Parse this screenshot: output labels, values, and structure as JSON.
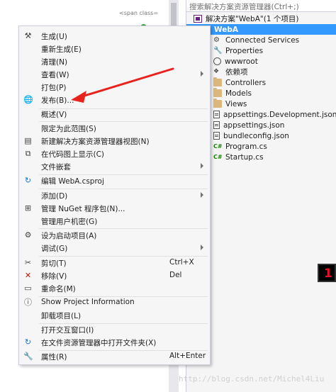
{
  "editor": {
    "top_snippet": "<span class="
  },
  "explorer": {
    "search_placeholder": "搜索解决方案资源管理器(Ctrl+;)",
    "items": [
      {
        "label": "解决方案\"WebA\"(1 个项目)",
        "icon": "solution-icon",
        "selected": false
      },
      {
        "label": "WebA",
        "icon": "project-icon",
        "selected": true
      },
      {
        "label": "Connected Services",
        "icon": "connected-services-icon",
        "selected": false
      },
      {
        "label": "Properties",
        "icon": "properties-icon",
        "selected": false
      },
      {
        "label": "wwwroot",
        "icon": "globe-icon",
        "selected": false
      },
      {
        "label": "依赖项",
        "icon": "dependencies-icon",
        "selected": false
      },
      {
        "label": "Controllers",
        "icon": "folder-icon",
        "selected": false
      },
      {
        "label": "Models",
        "icon": "folder-icon",
        "selected": false
      },
      {
        "label": "Views",
        "icon": "folder-icon",
        "selected": false
      },
      {
        "label": "appsettings.Development.json",
        "icon": "json-file-icon",
        "selected": false
      },
      {
        "label": "appsettings.json",
        "icon": "json-file-icon",
        "selected": false
      },
      {
        "label": "bundleconfig.json",
        "icon": "json-file-icon",
        "selected": false
      },
      {
        "label": "Program.cs",
        "icon": "csharp-file-icon",
        "selected": false
      },
      {
        "label": "Startup.cs",
        "icon": "csharp-file-icon",
        "selected": false
      }
    ]
  },
  "context_menu": {
    "items": [
      {
        "label": "生成(U)",
        "icon": "build-icon"
      },
      {
        "label": "重新生成(E)"
      },
      {
        "label": "清理(N)"
      },
      {
        "label": "查看(W)",
        "submenu": true
      },
      {
        "label": "打包(P)"
      },
      {
        "label": "发布(B)...",
        "icon": "publish-globe-icon"
      },
      {
        "label": "概述(V)"
      },
      {
        "label": "限定为此范围(S)"
      },
      {
        "label": "新建解决方案资源管理器视图(N)",
        "icon": "new-view-icon"
      },
      {
        "label": "在代码图上显示(C)",
        "icon": "code-map-icon"
      },
      {
        "label": "文件嵌套",
        "submenu": true
      },
      {
        "label": "编辑 WebA.csproj",
        "icon": "edit-project-icon"
      },
      {
        "label": "添加(D)",
        "submenu": true
      },
      {
        "label": "管理 NuGet 程序包(N)...",
        "icon": "nuget-icon"
      },
      {
        "label": "管理用户机密(G)"
      },
      {
        "label": "设为启动项目(A)",
        "icon": "gear-icon"
      },
      {
        "label": "调试(G)",
        "submenu": true
      },
      {
        "label": "剪切(T)",
        "icon": "scissors-icon",
        "shortcut": "Ctrl+X"
      },
      {
        "label": "移除(V)",
        "icon": "remove-x-icon",
        "shortcut": "Del"
      },
      {
        "label": "重命名(M)",
        "icon": "rename-icon"
      },
      {
        "label": "Show Project Information",
        "icon": "info-icon"
      },
      {
        "label": "卸载项目(L)"
      },
      {
        "label": "打开交互窗口(I)"
      },
      {
        "label": "在文件资源管理器中打开文件夹(X)",
        "icon": "open-folder-icon"
      },
      {
        "label": "属性(R)",
        "icon": "wrench-icon",
        "shortcut": "Alt+Enter"
      }
    ]
  },
  "annotation": {
    "arrow_color": "#e8231e",
    "badge_text": "1"
  },
  "watermark": "http://blog.csdn.net/Michel4Liu",
  "colors": {
    "selection": "#3399ff",
    "menu_bg": "#f6f6f6",
    "menu_border": "#cccedb"
  }
}
